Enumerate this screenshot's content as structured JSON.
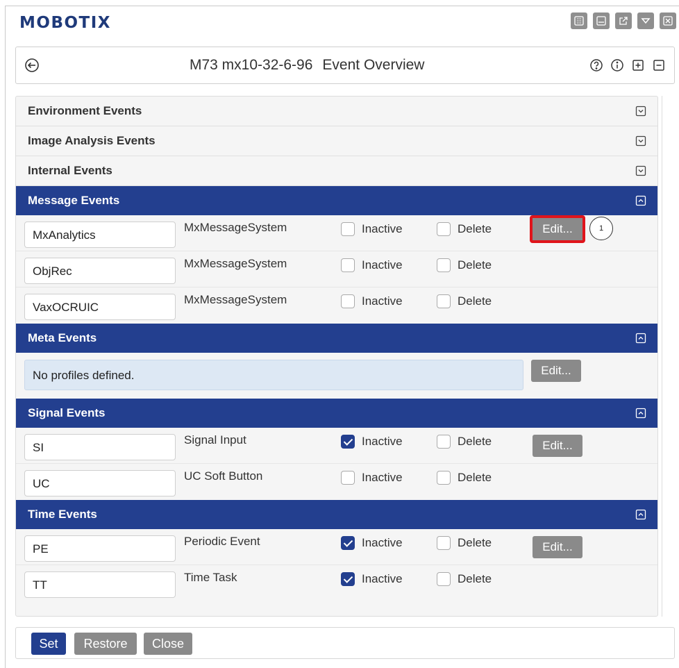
{
  "app": {
    "logo": "MOBOTIX"
  },
  "window_icons": [
    "grid-icon",
    "minimize-icon",
    "external-link-icon",
    "dropdown-icon",
    "close-icon"
  ],
  "titlebar": {
    "camera": "M73 mx10-32-6-96",
    "page": "Event Overview"
  },
  "title_icons": [
    "help-icon",
    "info-icon",
    "expand-all-icon",
    "collapse-all-icon"
  ],
  "sections": {
    "environment": {
      "label": "Environment Events",
      "expanded": false
    },
    "image_analysis": {
      "label": "Image Analysis Events",
      "expanded": false
    },
    "internal": {
      "label": "Internal Events",
      "expanded": false
    },
    "message": {
      "label": "Message Events",
      "expanded": true,
      "rows": [
        {
          "name": "MxAnalytics",
          "type": "MxMessageSystem",
          "inactive_label": "Inactive",
          "inactive": false,
          "delete_label": "Delete",
          "delete": false,
          "edit_label": "Edit...",
          "callout": "1"
        },
        {
          "name": "ObjRec",
          "type": "MxMessageSystem",
          "inactive_label": "Inactive",
          "inactive": false,
          "delete_label": "Delete",
          "delete": false
        },
        {
          "name": "VaxOCRUIC",
          "type": "MxMessageSystem",
          "inactive_label": "Inactive",
          "inactive": false,
          "delete_label": "Delete",
          "delete": false
        }
      ]
    },
    "meta": {
      "label": "Meta Events",
      "expanded": true,
      "empty_text": "No profiles defined.",
      "edit_label": "Edit..."
    },
    "signal": {
      "label": "Signal Events",
      "expanded": true,
      "rows": [
        {
          "name": "SI",
          "type": "Signal Input",
          "inactive_label": "Inactive",
          "inactive": true,
          "delete_label": "Delete",
          "delete": false,
          "edit_label": "Edit..."
        },
        {
          "name": "UC",
          "type": "UC Soft Button",
          "inactive_label": "Inactive",
          "inactive": false,
          "delete_label": "Delete",
          "delete": false
        }
      ]
    },
    "time": {
      "label": "Time Events",
      "expanded": true,
      "rows": [
        {
          "name": "PE",
          "type": "Periodic Event",
          "inactive_label": "Inactive",
          "inactive": true,
          "delete_label": "Delete",
          "delete": false,
          "edit_label": "Edit..."
        },
        {
          "name": "TT",
          "type": "Time Task",
          "inactive_label": "Inactive",
          "inactive": true,
          "delete_label": "Delete",
          "delete": false
        }
      ]
    }
  },
  "footer": {
    "set": "Set",
    "restore": "Restore",
    "close": "Close"
  },
  "colors": {
    "brand": "#1f3a7a",
    "section_header": "#233f8f",
    "button_gray": "#8a8a8a",
    "highlight": "#e0141b"
  }
}
